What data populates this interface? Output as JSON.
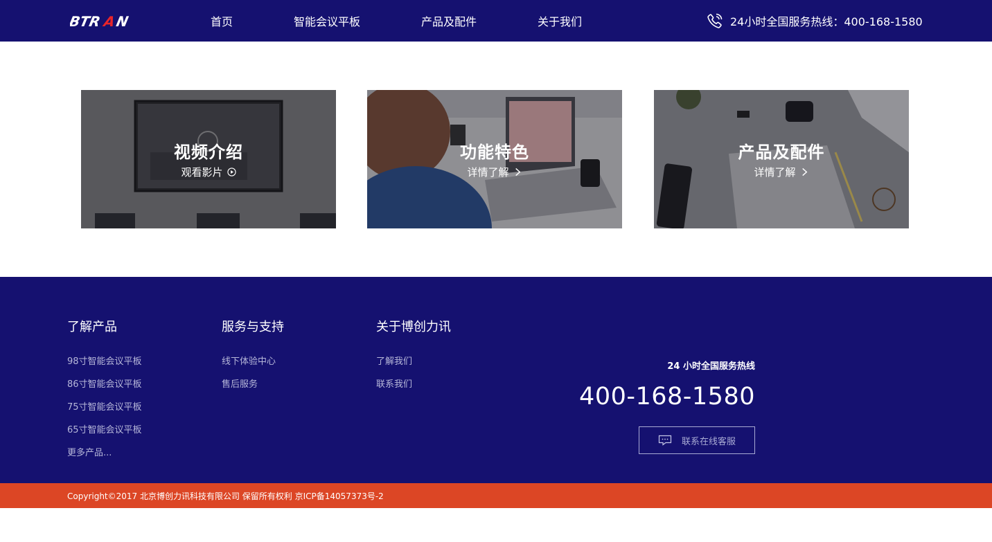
{
  "header": {
    "logo_text": "BTRAN",
    "nav": [
      "首页",
      "智能会议平板",
      "产品及配件",
      "关于我们"
    ],
    "hotline": "24小时全国服务热线：400-168-1580",
    "phone_icon": "phone-icon"
  },
  "cards": [
    {
      "title": "视频介绍",
      "sub": "观看影片",
      "icon": "play-circle-icon"
    },
    {
      "title": "功能特色",
      "sub": "详情了解",
      "icon": "chevron-right-icon"
    },
    {
      "title": "产品及配件",
      "sub": "详情了解",
      "icon": "chevron-right-icon"
    }
  ],
  "footer": {
    "columns": [
      {
        "heading": "了解产品",
        "links": [
          "98寸智能会议平板",
          "86寸智能会议平板",
          "75寸智能会议平板",
          "65寸智能会议平板",
          "更多产品..."
        ]
      },
      {
        "heading": "服务与支持",
        "links": [
          "线下体验中心",
          "售后服务"
        ]
      },
      {
        "heading": "关于博创力讯",
        "links": [
          "了解我们",
          "联系我们"
        ]
      }
    ],
    "service_label": "24 小时全国服务热线",
    "service_number": "400-168-1580",
    "chat_button": "联系在线客服",
    "chat_icon": "chat-bubble-icon",
    "copyright": "Copyright©2017 北京博创力讯科技有限公司 保留所有权利 京ICP备14057373号-2"
  },
  "colors": {
    "navy": "#151170",
    "accent": "#dc4625",
    "logo_red": "#e8252a"
  }
}
